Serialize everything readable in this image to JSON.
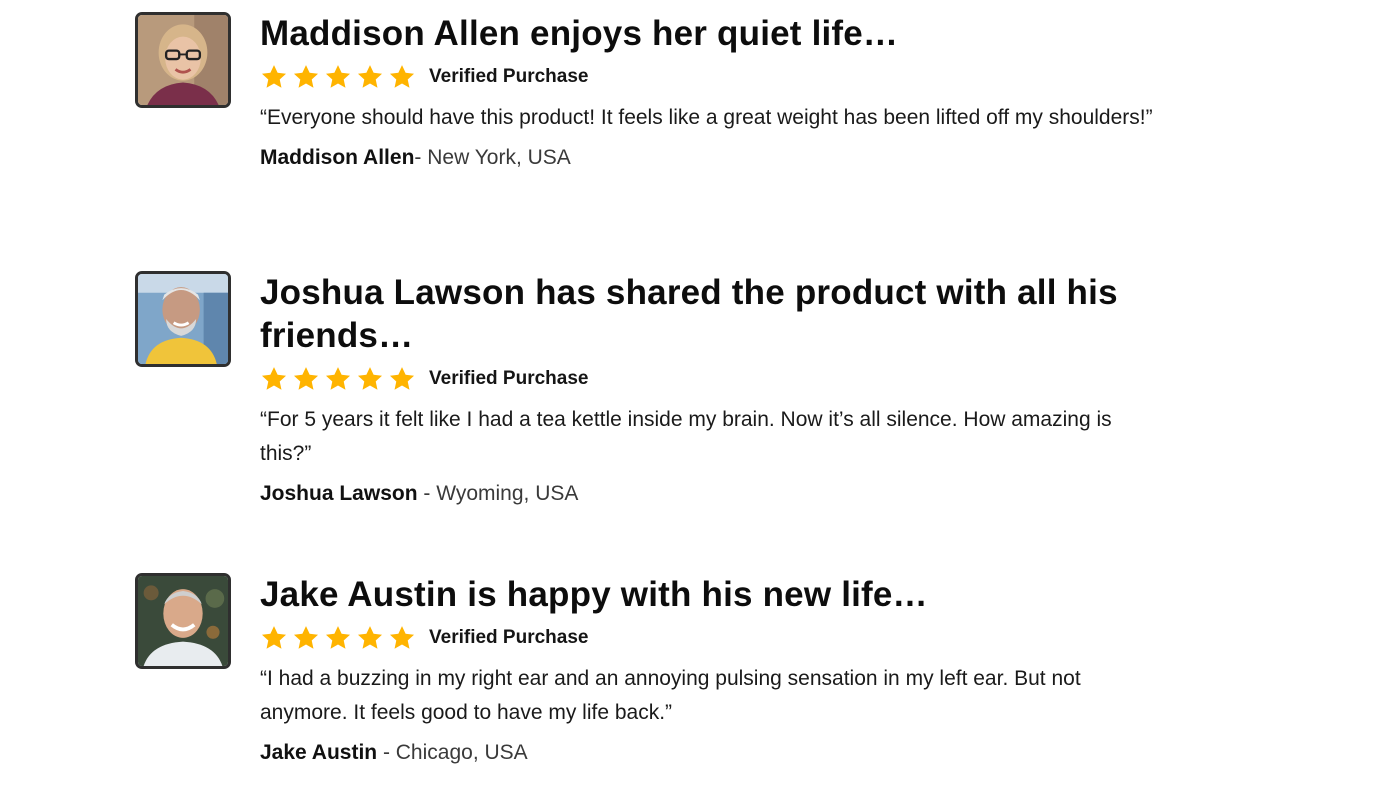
{
  "reviews": [
    {
      "headline": "Maddison Allen enjoys her quiet life…",
      "rating": 5,
      "verified_label": "Verified Purchase",
      "quote": "“Everyone should have this product! It feels like a great weight has been lifted off my shoulders!”",
      "author_name": "Maddison Allen",
      "author_location": "- New York, USA"
    },
    {
      "headline": "Joshua Lawson has shared the product with all his friends…",
      "rating": 5,
      "verified_label": "Verified Purchase",
      "quote": "“For 5 years it felt like I had a tea kettle inside my brain. Now it’s all silence. How amazing is this?”",
      "author_name": "Joshua Lawson",
      "author_location": " - Wyoming, USA"
    },
    {
      "headline": "Jake Austin is happy with his new life…",
      "rating": 5,
      "verified_label": "Verified Purchase",
      "quote": "“I had a buzzing in my right ear and an annoying pulsing sensation in my left ear. But not anymore. It feels good to have my life back.”",
      "author_name": "Jake Austin",
      "author_location": " - Chicago, USA"
    }
  ],
  "colors": {
    "star": "#FFB400",
    "avatar_border": "#2F2F2F"
  }
}
